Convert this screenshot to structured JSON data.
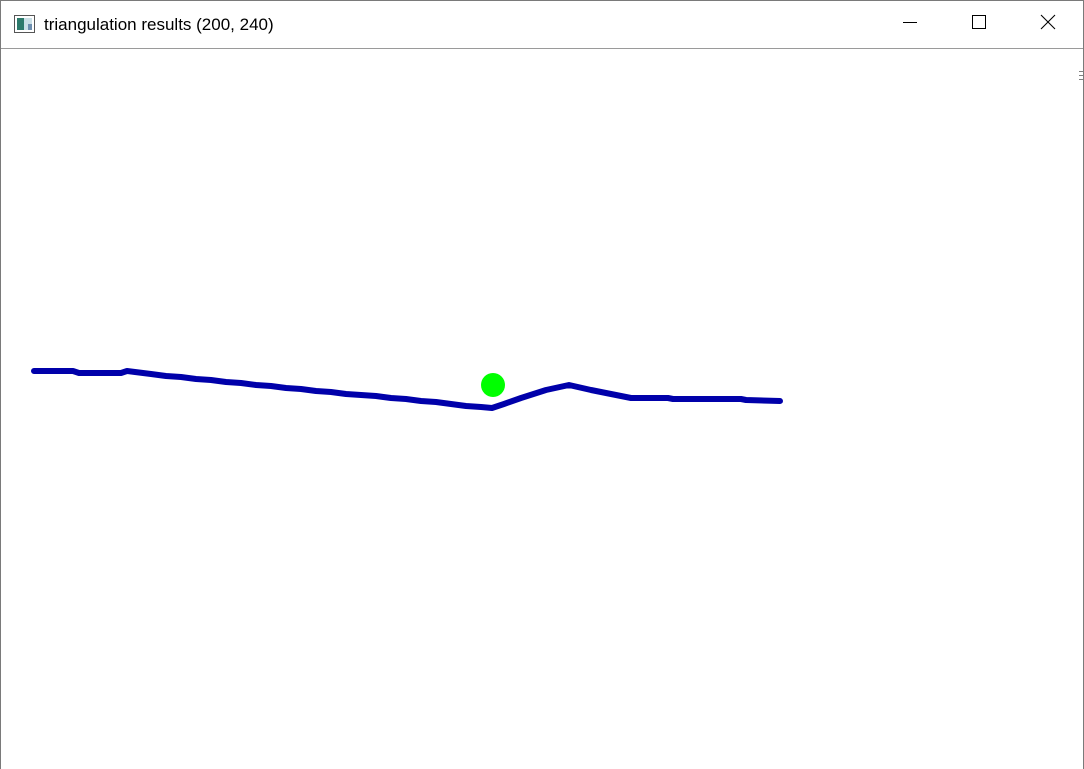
{
  "window": {
    "title": "triangulation results (200, 240)",
    "icon": "app-image-icon",
    "controls": {
      "minimize_icon": "minimize-icon",
      "maximize_icon": "maximize-icon",
      "close_icon": "close-icon"
    }
  },
  "canvas": {
    "background_color": "#ffffff",
    "polyline_color": "#0000aa",
    "marker_color": "#00ff00"
  }
}
